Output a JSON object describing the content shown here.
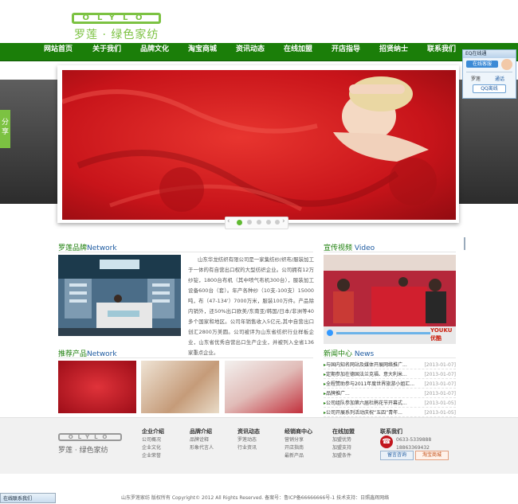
{
  "logo": {
    "latin": "OLYLO",
    "cn": "罗莲 · 绿色家纺"
  },
  "nav": [
    "网站首页",
    "关于我们",
    "品牌文化",
    "淘宝商城",
    "资讯动态",
    "在线加盟",
    "开店指导",
    "招贤纳士",
    "联系我们"
  ],
  "share_label": "分享",
  "qq_widget": {
    "title": "在线客服",
    "service": "在线咨询",
    "name": "罗莲",
    "chat": "通话",
    "qq_btn": "QQ离线"
  },
  "brand": {
    "title_cn": "罗莲品牌",
    "title_en": "Network",
    "text": "山东华龙纺织有限公司是一家集纺纱/织布/服装加工于一体的有自营出口权的大型纺织企业。公司拥有12万纱锭，1800台布机（其中喷气布机300台），服装加工设备600台（套）。年产各种纱（10支-100支）15000吨，布（47-134'）7000万米，服装100万件。产品除内销外，还50%出口欧美/东南亚/韩国/日本/非洲等40多个国家和地区。公司年销售收入5亿元,其中自营出口创汇2800万美圆。公司被评为山东省纺织行业样板企业，山东省优秀自营出口生产企业，并被列入全省136家重点企业。"
  },
  "video": {
    "title_cn": "宣传视频",
    "title_en": "Video",
    "brand_mark": "YOUKU 优酷"
  },
  "products": {
    "title_cn": "推荐产品",
    "title_en": "Network"
  },
  "news": {
    "title_cn": "新闻中心",
    "title_en": "News",
    "items": [
      {
        "text": "与国内知名网站及媒体开展网络推广...",
        "date": "[2013-01-07]"
      },
      {
        "text": "定期参加在德国法兰克福、意大利米...",
        "date": "[2013-01-07]"
      },
      {
        "text": "全程赞助参与2011年度世界旅游小姐汇...",
        "date": "[2013-01-07]"
      },
      {
        "text": "品牌推广...",
        "date": "[2013-01-07]"
      },
      {
        "text": "公司组队参加第六届杜鹃花节开幕式...",
        "date": "[2013-01-05]"
      },
      {
        "text": "公司开展系列活动庆祝“五四”青年...",
        "date": "[2013-01-05]"
      }
    ]
  },
  "footer": {
    "logo_latin": "OLYLO",
    "logo_cn": "罗莲 · 绿色家纺",
    "cols": [
      {
        "head": "企业介绍",
        "items": [
          "公司概况",
          "企业文化",
          "企业荣誉"
        ]
      },
      {
        "head": "品牌介绍",
        "items": [
          "品牌诠释",
          "形象代言人"
        ]
      },
      {
        "head": "资讯动态",
        "items": [
          "罗莲动态",
          "行业资讯"
        ]
      },
      {
        "head": "经销商中心",
        "items": [
          "营销分享",
          "开店指南",
          "最新产品"
        ]
      },
      {
        "head": "在线加盟",
        "items": [
          "加盟优势",
          "加盟支持",
          "加盟条件"
        ]
      }
    ],
    "contact": {
      "head": "联系我们",
      "phone1": "0633-5339888",
      "phone2": "18863369432",
      "msg_btn": "留言咨询",
      "shop_btn": "淘宝商城"
    }
  },
  "copyright": "山东罗莲家纺  版权所有 Copyright© 2012 All Rights Reserved.  备案号：鲁ICP备66666666号-1  技术支持：日照鑫辉网络",
  "bottom_bar": "在线联系我们",
  "colors": {
    "nav": "#1b7e09",
    "accent": "#7cc242",
    "title_blue": "#1d5aa0"
  }
}
